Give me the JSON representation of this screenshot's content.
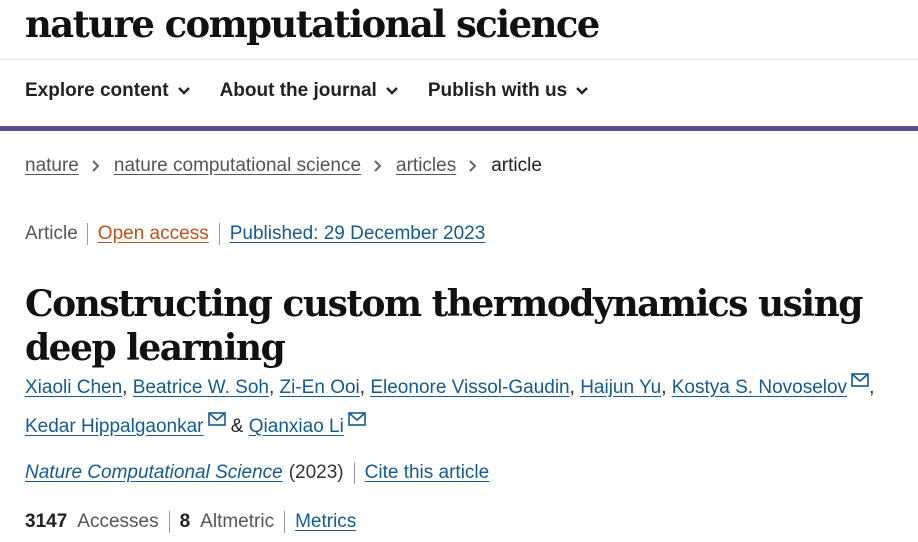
{
  "header": {
    "brand": "nature computational science"
  },
  "nav": {
    "items": [
      {
        "label": "Explore content"
      },
      {
        "label": "About the journal"
      },
      {
        "label": "Publish with us"
      }
    ]
  },
  "breadcrumb": {
    "items": [
      "nature",
      "nature computational science",
      "articles"
    ],
    "current": "article"
  },
  "article": {
    "type": "Article",
    "access": "Open access",
    "published": "Published: 29 December 2023",
    "title": "Constructing custom thermodynamics using deep learning",
    "authors": [
      {
        "name": "Xiaoli Chen"
      },
      {
        "name": "Beatrice W. Soh"
      },
      {
        "name": "Zi-En Ooi"
      },
      {
        "name": "Eleonore Vissol-Gaudin"
      },
      {
        "name": "Haijun Yu"
      },
      {
        "name": "Kostya S. Novoselov"
      },
      {
        "name": "Kedar Hippalgaonkar"
      },
      {
        "name": "Qianxiao Li"
      }
    ],
    "author_separator": ",",
    "author_last_joiner": "&",
    "journal": "Nature Computational Science",
    "year": "(2023)",
    "cite_label": "Cite this article",
    "accesses_count": "3147",
    "accesses_label": "Accesses",
    "altmetric_count": "8",
    "altmetric_label": "Altmetric",
    "metrics_label": "Metrics"
  },
  "colors": {
    "link": "#145b8f",
    "open_access": "#c2501c",
    "nav_bar": "#59508f"
  },
  "icons": {
    "nav_chevron": "chevron-down-icon",
    "breadcrumb_separator": "chevron-right-icon",
    "author_email": "mail-icon"
  }
}
